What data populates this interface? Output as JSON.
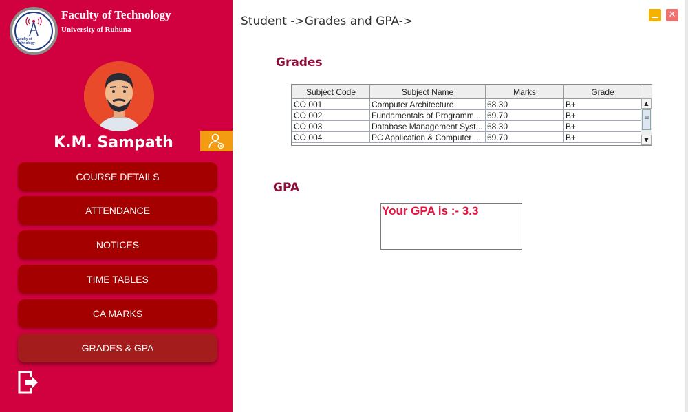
{
  "header": {
    "faculty_title": "Faculty of Technology",
    "university": "University of Ruhuna",
    "logo_text": "Faculty of Technology"
  },
  "user": {
    "name": "K.M. Sampath"
  },
  "nav": {
    "items": [
      {
        "label": "COURSE DETAILS"
      },
      {
        "label": "ATTENDANCE"
      },
      {
        "label": "NOTICES"
      },
      {
        "label": "TIME TABLES"
      },
      {
        "label": "CA MARKS"
      },
      {
        "label": "GRADES & GPA",
        "active": true
      }
    ]
  },
  "main": {
    "breadcrumb": "Student ->Grades and GPA->",
    "grades_title": "Grades",
    "gpa_title": "GPA",
    "gpa_text": "Your GPA is :- 3.3"
  },
  "grades_table": {
    "columns": [
      "Subject Code",
      "Subject Name",
      "Marks",
      "Grade"
    ],
    "rows": [
      [
        "CO 001",
        "Computer Architecture",
        "68.30",
        "B+"
      ],
      [
        "CO 002",
        "Fundamentals of Programm...",
        "69.70",
        "B+"
      ],
      [
        "CO 003",
        "Database Management Syst...",
        "68.30",
        "B+"
      ],
      [
        "CO 004",
        "PC Application & Computer ...",
        "69.70",
        "B+"
      ]
    ]
  },
  "colors": {
    "sidebar": "#d1003f",
    "nav_button": "#a50000",
    "title": "#8b0d3a",
    "gpa_text": "#e8103c",
    "profile_button": "#f39c12"
  },
  "icons": {
    "logout": "logout-icon",
    "profile": "user-settings-icon",
    "minimize": "minimize-icon",
    "close": "close-icon"
  }
}
